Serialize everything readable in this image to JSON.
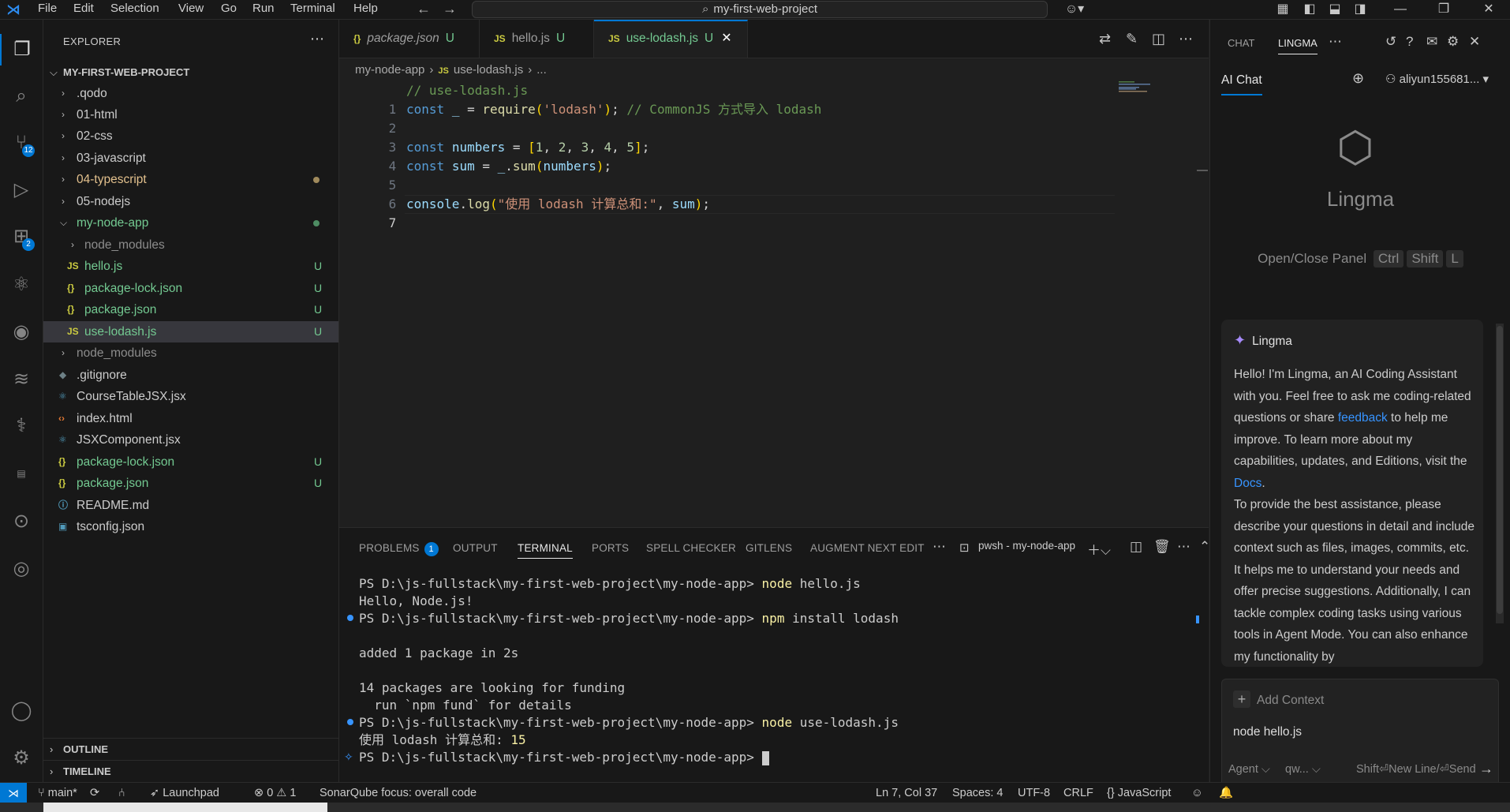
{
  "menu": [
    "File",
    "Edit",
    "Selection",
    "View",
    "Go",
    "Run",
    "Terminal",
    "Help"
  ],
  "command_center": "my-first-web-project",
  "activity": {
    "source_control_badge": "12",
    "extensions_badge": "2"
  },
  "explorer": {
    "title": "EXPLORER",
    "project": "MY-FIRST-WEB-PROJECT",
    "items": [
      {
        "label": ".qodo"
      },
      {
        "label": "01-html"
      },
      {
        "label": "02-css"
      },
      {
        "label": "03-javascript"
      },
      {
        "label": "04-typescript"
      },
      {
        "label": "05-nodejs"
      },
      {
        "label": "my-node-app"
      },
      {
        "label": "node_modules"
      },
      {
        "label": "hello.js",
        "status": "U"
      },
      {
        "label": "package-lock.json",
        "status": "U"
      },
      {
        "label": "package.json",
        "status": "U"
      },
      {
        "label": "use-lodash.js",
        "status": "U"
      },
      {
        "label": "node_modules"
      },
      {
        "label": ".gitignore"
      },
      {
        "label": "CourseTableJSX.jsx"
      },
      {
        "label": "index.html"
      },
      {
        "label": "JSXComponent.jsx"
      },
      {
        "label": "package-lock.json",
        "status": "U"
      },
      {
        "label": "package.json",
        "status": "U"
      },
      {
        "label": "README.md"
      },
      {
        "label": "tsconfig.json"
      }
    ],
    "outline": "OUTLINE",
    "timeline": "TIMELINE"
  },
  "tabs": [
    {
      "label": "package.json",
      "icon": "{}",
      "status": "U"
    },
    {
      "label": "hello.js",
      "icon": "JS",
      "status": "U"
    },
    {
      "label": "use-lodash.js",
      "icon": "JS",
      "status": "U"
    }
  ],
  "breadcrumb": {
    "folder": "my-node-app",
    "file": "use-lodash.js",
    "tail": "..."
  },
  "code": {
    "line_numbers": [
      "1",
      "2",
      "3",
      "4",
      "5",
      "6",
      "7"
    ],
    "l1": "// use-lodash.js",
    "l2_const": "const",
    "l2_var": "_",
    "l2_eq": " = ",
    "l2_fn": "require",
    "l2_str": "'lodash'",
    "l2_comment": "// CommonJS 方式导入 lodash",
    "l4_const": "const",
    "l4_var": "numbers",
    "l4_nums": [
      "1",
      "2",
      "3",
      "4",
      "5"
    ],
    "l5_const": "const",
    "l5_var": "sum",
    "l5_obj": "_",
    "l5_fn": "sum",
    "l5_arg": "numbers",
    "l7_obj": "console",
    "l7_fn": "log",
    "l7_str": "\"使用 lodash 计算总和:\"",
    "l7_arg": "sum"
  },
  "panel": {
    "tabs": [
      "PROBLEMS",
      "OUTPUT",
      "TERMINAL",
      "PORTS",
      "SPELL CHECKER",
      "GITLENS",
      "AUGMENT NEXT EDIT"
    ],
    "problems_count": "1",
    "terminal_name": "pwsh - my-node-app",
    "prompt": "PS D:\\js-fullstack\\my-first-web-project\\my-node-app>",
    "cmd1": "node",
    "cmd1_arg": "hello.js",
    "out1": "Hello, Node.js!",
    "cmd2": "npm",
    "cmd2_arg": "install lodash",
    "out2": "added 1 package in 2s",
    "out3": "14 packages are looking for funding",
    "out4": "  run `npm fund` for details",
    "cmd3": "node",
    "cmd3_arg": "use-lodash.js",
    "out5_text": "使用 lodash 计算总和: ",
    "out5_num": "15"
  },
  "right_panel": {
    "tab_chat": "CHAT",
    "tab_lingma": "LINGMA",
    "ai_chat": "AI Chat",
    "user": "aliyun155681...",
    "brand": "Lingma",
    "shortcut_label": "Open/Close Panel",
    "shortcut_keys": [
      "Ctrl",
      "Shift",
      "L"
    ],
    "welcome_title": "Lingma",
    "welcome_p1_a": "Hello! I'm Lingma, an AI Coding Assistant with you. Feel free to ask me coding-related questions or share ",
    "welcome_link1": "feedback",
    "welcome_p1_b": " to help me improve. To learn more about my capabilities, updates, and Editions, visit the ",
    "welcome_link2": "Docs",
    "welcome_p1_c": ".",
    "welcome_p2": "To provide the best assistance, please describe your questions in detail and include context such as files, images, commits, etc. It helps me to understand your needs and offer precise suggestions. Additionally, I can tackle complex coding tasks using various tools in Agent Mode. You can also enhance my functionality by",
    "add_context": "Add Context",
    "input_value": "node hello.js",
    "mode": "Agent",
    "model": "qw...",
    "send_hint": "Shift⏎New Line/⏎Send"
  },
  "status": {
    "branch": "main*",
    "launchpad": "Launchpad",
    "errors": "0",
    "warnings": "1",
    "sonar": "SonarQube focus: overall code",
    "position": "Ln 7, Col 37",
    "spaces": "Spaces: 4",
    "encoding": "UTF-8",
    "eol": "CRLF",
    "language": "JavaScript"
  }
}
